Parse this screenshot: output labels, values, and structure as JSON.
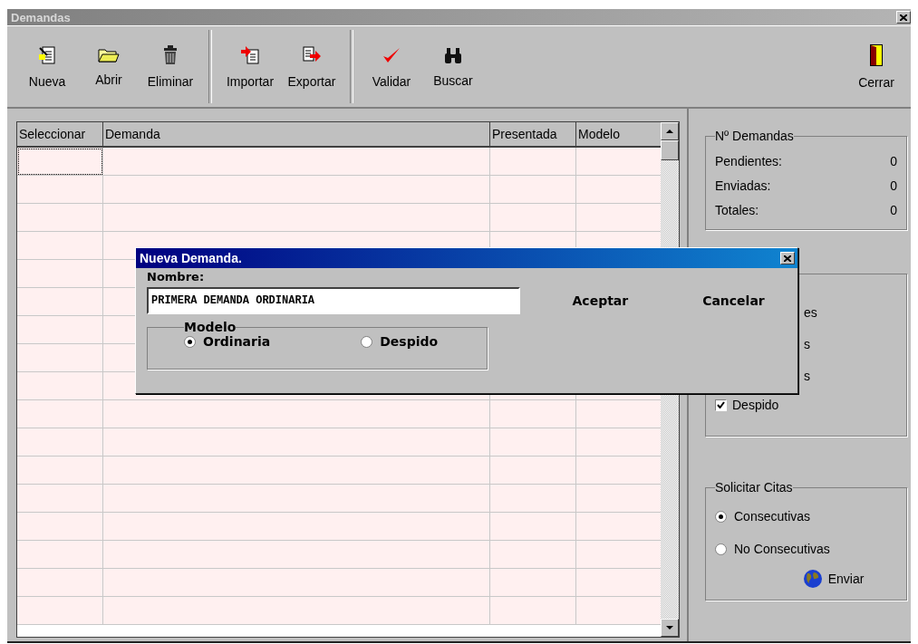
{
  "window": {
    "title": "Demandas"
  },
  "toolbar": {
    "groups": [
      [
        {
          "label": "Nueva"
        },
        {
          "label": "Abrir"
        },
        {
          "label": "Eliminar"
        }
      ],
      [
        {
          "label": "Importar"
        },
        {
          "label": "Exportar"
        }
      ],
      [
        {
          "label": "Validar"
        },
        {
          "label": "Buscar"
        }
      ]
    ],
    "end": {
      "label": "Cerrar"
    }
  },
  "table": {
    "columns": [
      "Seleccionar",
      "Demanda",
      "Presentada",
      "Modelo"
    ]
  },
  "stats": {
    "title": "Nº Demandas",
    "rows": [
      {
        "label": "Pendientes:",
        "value": "0"
      },
      {
        "label": "Enviadas:",
        "value": "0"
      },
      {
        "label": "Totales:",
        "value": "0"
      }
    ]
  },
  "filter": {
    "items": [
      {
        "kind": "fragment",
        "label": "es"
      },
      {
        "kind": "fragment",
        "label": "s"
      },
      {
        "kind": "fragment",
        "label": "s"
      },
      {
        "kind": "checkbox",
        "label": "Despido",
        "checked": true
      }
    ]
  },
  "citas": {
    "title": "Solicitar Citas",
    "options": [
      {
        "label": "Consecutivas",
        "selected": true
      },
      {
        "label": "No Consecutivas",
        "selected": false
      }
    ],
    "send": "Enviar"
  },
  "dialog": {
    "title": "Nueva Demanda.",
    "name_label": "Nombre:",
    "name_value": "PRIMERA DEMANDA ORDINARIA",
    "accept": "Aceptar",
    "cancel": "Cancelar",
    "model": {
      "title": "Modelo",
      "options": [
        {
          "label": "Ordinaria",
          "selected": true
        },
        {
          "label": "Despido",
          "selected": false
        }
      ]
    }
  }
}
